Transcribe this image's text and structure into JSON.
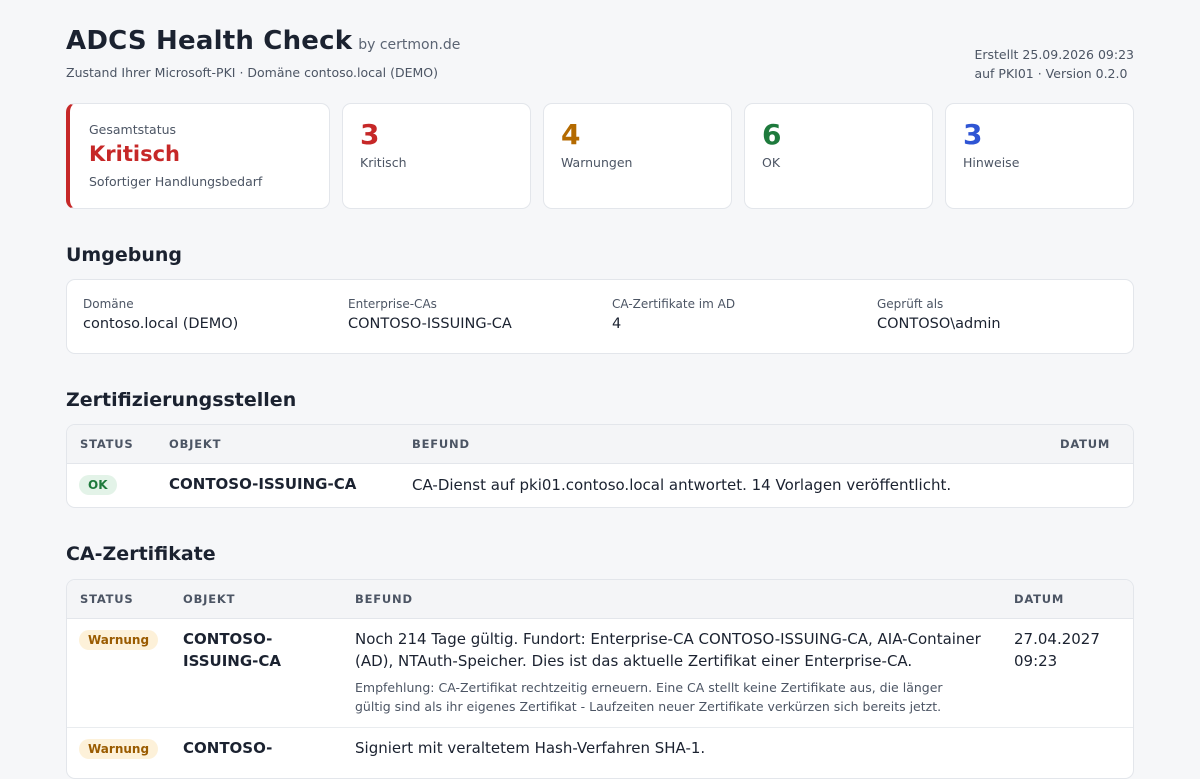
{
  "header": {
    "title": "ADCS Health Check",
    "by": "by certmon.de",
    "subtitle": "Zustand Ihrer Microsoft-PKI · Domäne contoso.local (DEMO)",
    "created": "Erstellt 25.09.2026 09:23",
    "host_version": "auf PKI01 · Version 0.2.0"
  },
  "summary": {
    "overall": {
      "label": "Gesamtstatus",
      "value": "Kritisch",
      "sub": "Sofortiger Handlungsbedarf",
      "color": "#c62828"
    },
    "stats": [
      {
        "count": "3",
        "label": "Kritisch",
        "color": "#c62828"
      },
      {
        "count": "4",
        "label": "Warnungen",
        "color": "#b46a00"
      },
      {
        "count": "6",
        "label": "OK",
        "color": "#1e7a3c"
      },
      {
        "count": "3",
        "label": "Hinweise",
        "color": "#2f55d4"
      }
    ]
  },
  "environment": {
    "heading": "Umgebung",
    "items": [
      {
        "key": "Domäne",
        "value": "contoso.local (DEMO)"
      },
      {
        "key": "Enterprise-CAs",
        "value": "CONTOSO-ISSUING-CA"
      },
      {
        "key": "CA-Zertifikate im AD",
        "value": "4"
      },
      {
        "key": "Geprüft als",
        "value": "CONTOSO\\admin"
      }
    ]
  },
  "cas": {
    "heading": "Zertifizierungsstellen",
    "columns": [
      "STATUS",
      "OBJEKT",
      "BEFUND",
      "DATUM"
    ],
    "rows": [
      {
        "status": "OK",
        "object": "CONTOSO-ISSUING-CA",
        "finding": "CA-Dienst auf pki01.contoso.local antwortet. 14 Vorlagen veröffentlicht.",
        "date": ""
      }
    ]
  },
  "ca_certs": {
    "heading": "CA-Zertifikate",
    "columns": [
      "STATUS",
      "OBJEKT",
      "BEFUND",
      "DATUM"
    ],
    "rows": [
      {
        "status": "Warnung",
        "object_line1": "CONTOSO-",
        "object_line2": "ISSUING-CA",
        "finding_line1": "Noch 214 Tage gültig. Fundort: Enterprise-CA CONTOSO-ISSUING-CA, AIA-Container",
        "finding_line2": "(AD), NTAuth-Speicher. Dies ist das aktuelle Zertifikat einer Enterprise-CA.",
        "reco_line1": "Empfehlung: CA-Zertifikat rechtzeitig erneuern. Eine CA stellt keine Zertifikate aus, die länger",
        "reco_line2": "gültig sind als ihr eigenes Zertifikat - Laufzeiten neuer Zertifikate verkürzen sich bereits jetzt.",
        "date_line1": "27.04.2027",
        "date_line2": "09:23"
      },
      {
        "status": "Warnung",
        "object_line1": "CONTOSO-",
        "finding_line1": "Signiert mit veraltetem Hash-Verfahren SHA-1."
      }
    ]
  }
}
